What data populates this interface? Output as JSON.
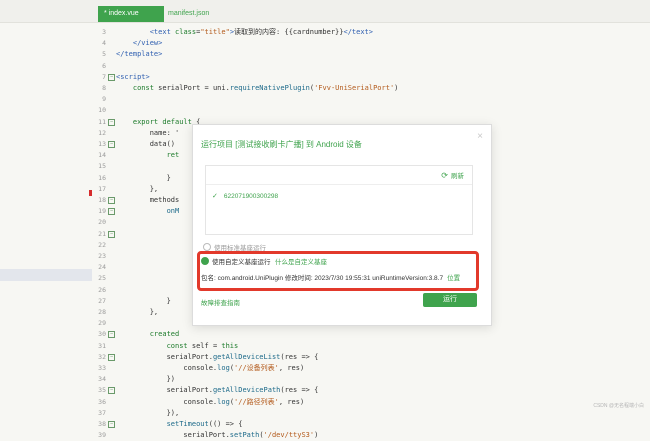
{
  "tabs": [
    {
      "label": "* index.vue",
      "active": true
    },
    {
      "label": "manifest.json",
      "active": false
    }
  ],
  "code_lines": [
    {
      "n": "3",
      "fold": false,
      "html": "        <span class=\"tag\">&lt;text</span> <span class=\"kw\">class</span>=<span class=\"str\">\"title\"</span><span class=\"tag\">&gt;</span>读取到的内容: {{cardnumber}}<span class=\"tag\">&lt;/text&gt;</span>"
    },
    {
      "n": "4",
      "fold": false,
      "html": "    <span class=\"tag\">&lt;/view&gt;</span>"
    },
    {
      "n": "5",
      "fold": false,
      "html": "<span class=\"tag\">&lt;/template&gt;</span>"
    },
    {
      "n": "6",
      "fold": false,
      "html": ""
    },
    {
      "n": "7",
      "fold": true,
      "html": "<span class=\"tag\">&lt;script&gt;</span>"
    },
    {
      "n": "8",
      "fold": false,
      "html": "    <span class=\"kw\">const</span> serialPort = uni.<span class=\"fn\">requireNativePlugin</span>(<span class=\"str\">'Fvv-UniSerialPort'</span>)"
    },
    {
      "n": "9",
      "fold": false,
      "html": ""
    },
    {
      "n": "10",
      "fold": false,
      "html": ""
    },
    {
      "n": "11",
      "fold": true,
      "html": "    <span class=\"kw\">export default</span> {"
    },
    {
      "n": "12",
      "fold": false,
      "html": "        name: '"
    },
    {
      "n": "13",
      "fold": true,
      "html": "        data()"
    },
    {
      "n": "14",
      "fold": false,
      "html": "            <span class=\"kw\">ret</span>"
    },
    {
      "n": "15",
      "fold": false,
      "html": ""
    },
    {
      "n": "16",
      "fold": false,
      "html": "            }"
    },
    {
      "n": "17",
      "fold": false,
      "html": "        },"
    },
    {
      "n": "18",
      "fold": true,
      "html": "        methods"
    },
    {
      "n": "19",
      "fold": true,
      "html": "            <span class=\"fn\">onM</span>"
    },
    {
      "n": "20",
      "fold": false,
      "html": ""
    },
    {
      "n": "21",
      "fold": true,
      "html": ""
    },
    {
      "n": "22",
      "fold": false,
      "html": ""
    },
    {
      "n": "23",
      "fold": false,
      "html": ""
    },
    {
      "n": "24",
      "fold": false,
      "html": ""
    },
    {
      "n": "25",
      "fold": false,
      "html": ""
    },
    {
      "n": "26",
      "fold": false,
      "html": ""
    },
    {
      "n": "27",
      "fold": false,
      "html": "            }"
    },
    {
      "n": "28",
      "fold": false,
      "html": "        },"
    },
    {
      "n": "29",
      "fold": false,
      "html": ""
    },
    {
      "n": "30",
      "fold": true,
      "html": "        <span class=\"kw\">created</span>"
    },
    {
      "n": "31",
      "fold": false,
      "html": "            <span class=\"kw\">const</span> self = <span class=\"kw\">this</span>"
    },
    {
      "n": "32",
      "fold": true,
      "html": "            serialPort.<span class=\"fn\">getAllDeviceList</span>(res =&gt; {"
    },
    {
      "n": "33",
      "fold": false,
      "html": "                console.<span class=\"fn\">log</span>(<span class=\"str\">'//设备列表'</span>, res)"
    },
    {
      "n": "34",
      "fold": false,
      "html": "            })"
    },
    {
      "n": "35",
      "fold": true,
      "html": "            serialPort.<span class=\"fn\">getAllDevicePath</span>(res =&gt; {"
    },
    {
      "n": "36",
      "fold": false,
      "html": "                console.<span class=\"fn\">log</span>(<span class=\"str\">'//路径列表'</span>, res)"
    },
    {
      "n": "37",
      "fold": false,
      "html": "            }),"
    },
    {
      "n": "38",
      "fold": true,
      "html": "            <span class=\"fn\">setTimeout</span>(() =&gt; {"
    },
    {
      "n": "39",
      "fold": false,
      "html": "                serialPort.<span class=\"fn\">setPath</span>(<span class=\"str\">'/dev/ttyS3'</span>)"
    }
  ],
  "dialog": {
    "title": "运行项目 [测试接收刷卡广播] 到 Android 设备",
    "close": "×",
    "refresh_label": "刷新",
    "refresh_icon": "refresh-icon",
    "device_id": "622071900300298",
    "option_standard": "使用标准基座运行",
    "option_custom": "使用自定义基座运行",
    "custom_link": "什么是自定义基座",
    "package_info": "包名: com.android.UniPlugin  修改时间: 2023/7/30 19:55:31  uniRuntimeVersion:3.8.7",
    "location_link": "位置",
    "guide_link": "故障排查指南",
    "run_button": "运行"
  },
  "watermark": "CSDN @无名程端小白"
}
